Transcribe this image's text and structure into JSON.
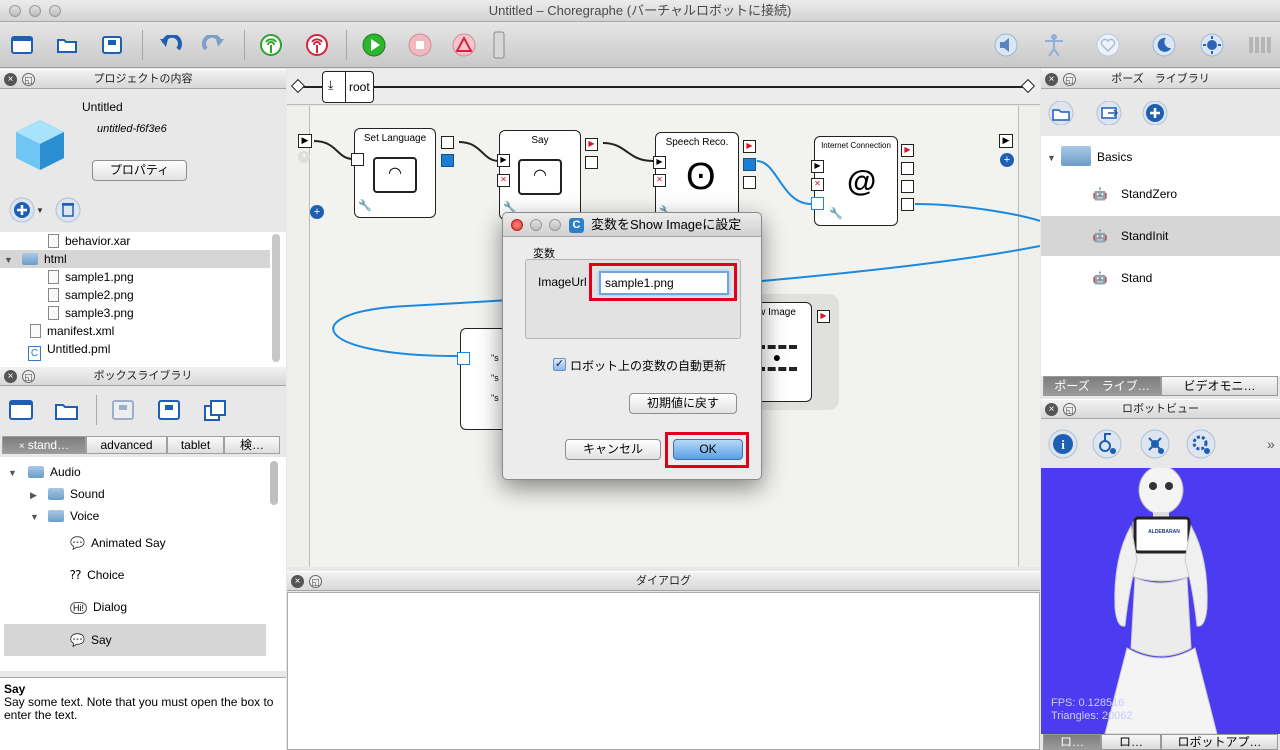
{
  "window": {
    "title": "Untitled – Choregraphe (バーチャルロボットに接続)"
  },
  "project_panel": {
    "header": "プロジェクトの内容",
    "project_name": "Untitled",
    "project_id": "untitled-f6f3e6",
    "properties_button": "プロパティ",
    "files": [
      {
        "label": "behavior.xar",
        "type": "file"
      },
      {
        "label": "html",
        "type": "folder"
      },
      {
        "label": "sample1.png",
        "type": "file"
      },
      {
        "label": "sample2.png",
        "type": "file"
      },
      {
        "label": "sample3.png",
        "type": "file"
      },
      {
        "label": "manifest.xml",
        "type": "file"
      },
      {
        "label": "Untitled.pml",
        "type": "file"
      }
    ]
  },
  "box_library": {
    "header": "ボックスライブラリ",
    "tabs": [
      "stand…",
      "advanced",
      "tablet",
      "検…"
    ],
    "tree": [
      "Audio",
      "Sound",
      "Voice",
      "Animated Say",
      "Choice",
      "Dialog",
      "Say"
    ],
    "description_title": "Say",
    "description_text": "Say some text. Note that you must open the box to enter the text."
  },
  "flow": {
    "breadcrumb": "root",
    "boxes": [
      "Set Language",
      "Say",
      "Speech Reco.",
      "Internet Connection",
      "w Image"
    ],
    "string_snippets": [
      "\"s",
      "\"s",
      "\"s"
    ]
  },
  "dialog_panel": {
    "header": "ダイアログ"
  },
  "pose_library": {
    "header": "ポーズ　ライブラリ",
    "folder": "Basics",
    "poses": [
      "StandZero",
      "StandInit",
      "Stand"
    ],
    "tabs": [
      "ポーズ　ライブ…",
      "ビデオモニ…"
    ]
  },
  "robot_view": {
    "header": "ロボットビュー",
    "screen_label": "ALDEBARAN",
    "fps_label": "FPS: 0.128516",
    "triangles_label": "Triangles: 20062",
    "bottom_tabs": [
      "ロ…",
      "ロ…",
      "ロボットアプ…"
    ]
  },
  "modal": {
    "title": "変数をShow Imageに設定",
    "group_label": "変数",
    "field_label": "ImageUrl",
    "field_value": "sample1.png",
    "checkbox_label": "ロボット上の変数の自動更新",
    "reset_button": "初期値に戻す",
    "cancel_button": "キャンセル",
    "ok_button": "OK"
  },
  "colors": {
    "highlight_red": "#e1001b",
    "link_blue": "#1a8ae0",
    "robot_bg": "#4b3cf2"
  }
}
